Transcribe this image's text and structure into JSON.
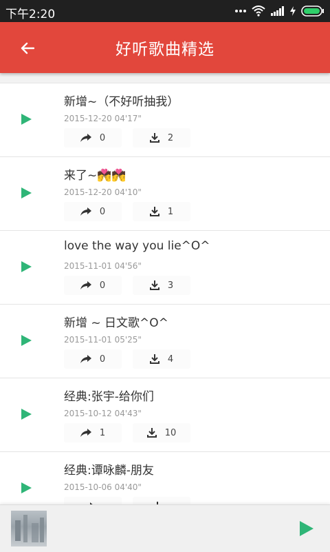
{
  "status_bar": {
    "time": "下午2:20"
  },
  "app_bar": {
    "title": "好听歌曲精选"
  },
  "songs": [
    {
      "title": "新增~（不好听抽我）",
      "date": "2015-12-20",
      "duration": "04'17\"",
      "shares": "0",
      "downloads": "2"
    },
    {
      "title": "来了~",
      "emoji": "💏💏",
      "date": "2015-12-20",
      "duration": "04'10\"",
      "shares": "0",
      "downloads": "1"
    },
    {
      "title": "love the way you lie^O^",
      "date": "2015-11-01",
      "duration": "04'56\"",
      "shares": "0",
      "downloads": "3"
    },
    {
      "title": "新增 ~ 日文歌^O^",
      "date": "2015-11-01",
      "duration": "05'25\"",
      "shares": "0",
      "downloads": "4"
    },
    {
      "title": "经典:张宇-给你们",
      "date": "2015-10-12",
      "duration": "04'43\"",
      "shares": "1",
      "downloads": "10"
    },
    {
      "title": "经典:谭咏麟-朋友",
      "date": "2015-10-06",
      "duration": "04'40\"",
      "shares": "",
      "downloads": ""
    }
  ],
  "colors": {
    "accent": "#e2473c",
    "play": "#2fb577",
    "status_bar": "#202020"
  },
  "icons": {
    "back": "arrow-left-icon",
    "play": "play-icon",
    "share": "share-icon",
    "download": "download-icon",
    "wifi": "wifi-icon",
    "signal": "signal-icon",
    "battery": "battery-icon"
  }
}
